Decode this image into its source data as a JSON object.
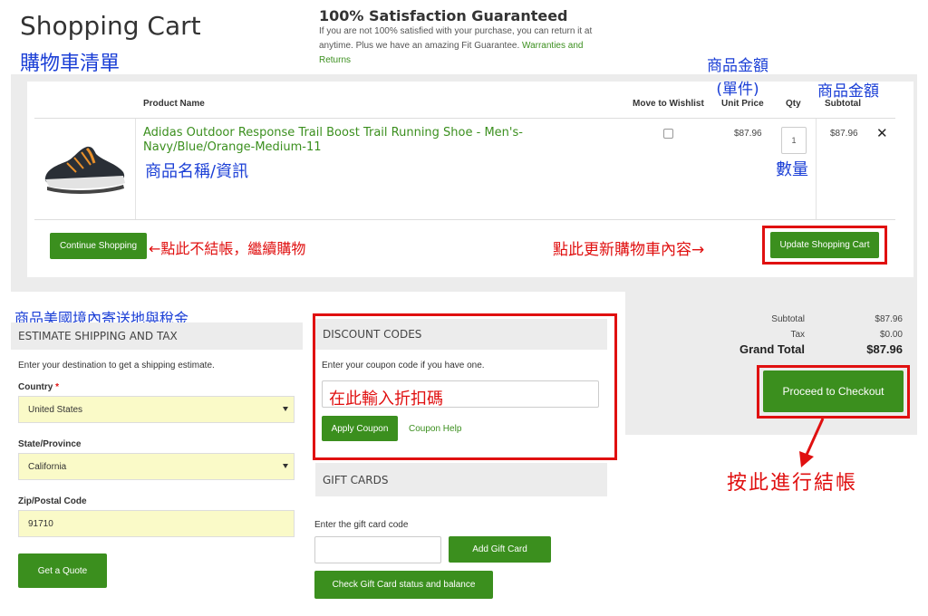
{
  "header": {
    "title": "Shopping Cart",
    "title_annotation": "購物車清單",
    "satisfaction_title": "100% Satisfaction Guaranteed",
    "satisfaction_text": "If you are not 100% satisfied with your purchase, you can return it at anytime. Plus we have an amazing Fit Guarantee.",
    "satisfaction_link": "Warranties and Returns"
  },
  "cart": {
    "columns": {
      "product_name": "Product Name",
      "move_to_wishlist": "Move to Wishlist",
      "unit_price": "Unit Price",
      "qty": "Qty",
      "subtotal": "Subtotal"
    },
    "item": {
      "name": "Adidas Outdoor Response Trail Boost Trail Running Shoe - Men's-Navy/Blue/Orange-Medium-11",
      "unit_price": "$87.96",
      "qty": "1",
      "subtotal": "$87.96",
      "remove_symbol": "✕"
    },
    "continue_shopping_label": "Continue Shopping",
    "update_cart_label": "Update Shopping Cart"
  },
  "annotations": {
    "unit_price": "商品金額\n(單件)",
    "subtotal": "商品金額",
    "product_info": "商品名稱/資訊",
    "qty": "數量",
    "continue_shopping": "←點此不結帳，繼續購物",
    "update_cart": "點此更新購物車內容→",
    "shipping_tax": "商品美國境內寄送地與稅金",
    "coupon_input": "在此輸入折扣碼",
    "checkout": "按此進行結帳"
  },
  "shipping": {
    "title": "ESTIMATE SHIPPING AND TAX",
    "intro": "Enter your destination to get a shipping estimate.",
    "country_label": "Country",
    "required_mark": "*",
    "country_value": "United States",
    "state_label": "State/Province",
    "state_value": "California",
    "zip_label": "Zip/Postal Code",
    "zip_value": "91710",
    "quote_button": "Get a Quote"
  },
  "discount": {
    "title": "DISCOUNT CODES",
    "intro": "Enter your coupon code if you have one.",
    "apply_button": "Apply Coupon",
    "help_link": "Coupon Help"
  },
  "gift_cards": {
    "title": "GIFT CARDS",
    "label": "Enter the gift card code",
    "add_button": "Add Gift Card",
    "check_button": "Check Gift Card status and balance"
  },
  "summary": {
    "subtotal_label": "Subtotal",
    "subtotal_value": "$87.96",
    "tax_label": "Tax",
    "tax_value": "$0.00",
    "grand_total_label": "Grand Total",
    "grand_total_value": "$87.96",
    "checkout_button": "Proceed to Checkout"
  },
  "colors": {
    "brand_green": "#3b8f1e",
    "annotation_blue": "#1b3fd6",
    "annotation_red": "#e01010",
    "select_bg": "#fafac8"
  }
}
